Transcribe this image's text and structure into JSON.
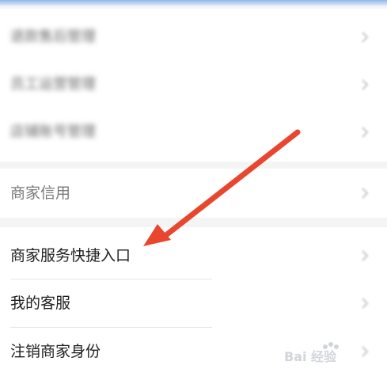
{
  "settings_top": {
    "items": [
      {
        "label": "退款售后管理"
      },
      {
        "label": "员工运营管理"
      },
      {
        "label": "店铺账号管理"
      }
    ]
  },
  "credit_section": {
    "label": "商家信用"
  },
  "service_section": {
    "items": [
      {
        "label": "商家服务快捷入口"
      },
      {
        "label": "我的客服"
      },
      {
        "label": "注销商家身份"
      }
    ]
  },
  "annotation": {
    "arrow_color": "#e8462e"
  },
  "watermark": {
    "label": "Bai 经验"
  },
  "icons": {
    "row_chevron": "chevron-right-icon",
    "arrow": "arrow-annotation-icon"
  }
}
